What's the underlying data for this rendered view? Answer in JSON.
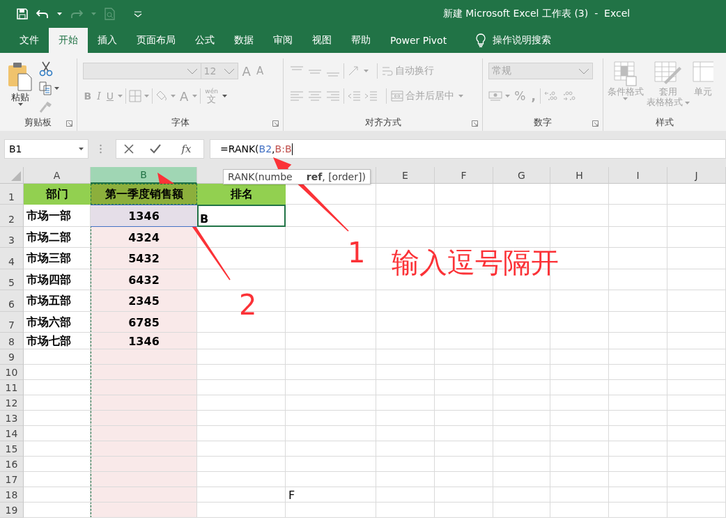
{
  "title_bar": {
    "title": "新建 Microsoft Excel 工作表 (3)  -  Excel"
  },
  "menu_tabs": [
    {
      "label": "文件",
      "selected": false
    },
    {
      "label": "开始",
      "selected": true
    },
    {
      "label": "插入",
      "selected": false
    },
    {
      "label": "页面布局",
      "selected": false
    },
    {
      "label": "公式",
      "selected": false
    },
    {
      "label": "数据",
      "selected": false
    },
    {
      "label": "审阅",
      "selected": false
    },
    {
      "label": "视图",
      "selected": false
    },
    {
      "label": "帮助",
      "selected": false
    },
    {
      "label": "Power Pivot",
      "selected": false
    }
  ],
  "tell_me": {
    "label": "操作说明搜索"
  },
  "ribbon": {
    "disabled": true,
    "clipboard": {
      "title": "剪贴板",
      "paste": "粘贴"
    },
    "font": {
      "title": "字体",
      "font_size": "12",
      "grow": "A",
      "shrink": "A",
      "bold": "B",
      "italic": "I",
      "underline": "U",
      "font_color": "A",
      "phonetic_top": "wén",
      "phonetic_char": "文"
    },
    "alignment": {
      "title": "对齐方式",
      "wrap": "自动换行",
      "merge": "合并后居中"
    },
    "number": {
      "title": "数字",
      "format": "常规",
      "percent": "%",
      "comma": ","
    },
    "styles": {
      "title": "样式",
      "conditional_format": "条件格式",
      "table_format_top": "套用",
      "table_format_bottom": "表格格式",
      "cell_styles": "单元"
    }
  },
  "formula_bar": {
    "name_box": "B1",
    "function_button": "fx",
    "formula": [
      {
        "text": "=RANK(",
        "color": "#000000"
      },
      {
        "text": "B2",
        "color": "#4472c4"
      },
      {
        "text": ",",
        "color": "#000000"
      },
      {
        "text": "B:B",
        "color": "#c0504d"
      }
    ]
  },
  "tooltip": {
    "parts": [
      "RANK(numbe",
      "**ref**, [order])"
    ]
  },
  "sheet": {
    "columns": [
      {
        "label": "A",
        "selected": false
      },
      {
        "label": "B",
        "selected": true
      },
      {
        "selected": false
      },
      {
        "selected": false
      },
      {
        "label": "E",
        "selected": false
      },
      {
        "label": "F",
        "selected": false
      },
      {
        "label": "G",
        "selected": false
      },
      {
        "label": "H",
        "selected": false
      },
      {
        "label": "I",
        "selected": false
      },
      {
        "label": "J",
        "selected": false
      }
    ],
    "rows": [
      {
        "number": "1",
        "kind": "header",
        "cells": [
          {
            "text": "部门",
            "bold": true,
            "active": false,
            "referenced": false
          },
          {
            "text": "第一季度销售额",
            "bold": true,
            "active": false,
            "referenced": false
          },
          {
            "text": "排名",
            "bold": true,
            "active": false,
            "referenced": false
          }
        ]
      },
      {
        "number": "2",
        "kind": "data",
        "cells": [
          {
            "text": "市场一部",
            "bold": true,
            "active": false,
            "referenced": false
          },
          {
            "text": "1346",
            "bold": true,
            "active": false,
            "referenced": true
          },
          {
            "text": "B",
            "bold": true,
            "active": true,
            "referenced": false
          }
        ]
      },
      {
        "number": "3",
        "kind": "data",
        "cells": [
          {
            "text": "市场二部",
            "bold": true,
            "active": false,
            "referenced": false
          },
          {
            "text": "4324",
            "bold": true,
            "active": false,
            "referenced": false
          }
        ]
      },
      {
        "number": "4",
        "kind": "data",
        "cells": [
          {
            "text": "市场三部",
            "bold": true,
            "active": false,
            "referenced": false
          },
          {
            "text": "5432",
            "bold": true,
            "active": false,
            "referenced": false
          }
        ]
      },
      {
        "number": "5",
        "kind": "data",
        "cells": [
          {
            "text": "市场四部",
            "bold": true,
            "active": false,
            "referenced": false
          },
          {
            "text": "6432",
            "bold": true,
            "active": false,
            "referenced": false
          }
        ]
      },
      {
        "number": "6",
        "kind": "data",
        "cells": [
          {
            "text": "市场五部",
            "bold": true,
            "active": false,
            "referenced": false
          },
          {
            "text": "2345",
            "bold": true,
            "active": false,
            "referenced": false
          }
        ]
      },
      {
        "number": "7",
        "kind": "data",
        "cells": [
          {
            "text": "市场六部",
            "bold": true,
            "active": false,
            "referenced": false
          },
          {
            "text": "6785",
            "bold": true,
            "active": false,
            "referenced": false
          }
        ]
      },
      {
        "number": "8",
        "kind": "data",
        "cells": [
          {
            "text": "市场七部",
            "bold": true,
            "active": false,
            "referenced": false
          },
          {
            "text": "1346",
            "bold": true,
            "active": false,
            "referenced": false
          }
        ]
      },
      {
        "number": "9",
        "kind": "data"
      },
      {
        "number": "10",
        "kind": "data"
      },
      {
        "number": "11",
        "kind": "data"
      },
      {
        "number": "12",
        "kind": "data"
      },
      {
        "number": "13",
        "kind": "data"
      },
      {
        "number": "14",
        "kind": "data"
      },
      {
        "number": "15",
        "kind": "data"
      },
      {
        "number": "16",
        "kind": "data"
      },
      {
        "number": "17",
        "kind": "data"
      },
      {
        "number": "18",
        "kind": "data",
        "cells": [
          null,
          null,
          null,
          {
            "text": "F",
            "bold": false,
            "active": false,
            "referenced": false
          }
        ]
      },
      {
        "number": "19",
        "kind": "data"
      }
    ]
  },
  "annotations": {
    "step_1": "1",
    "note": "输入逗号隔开",
    "step_2": "2"
  }
}
